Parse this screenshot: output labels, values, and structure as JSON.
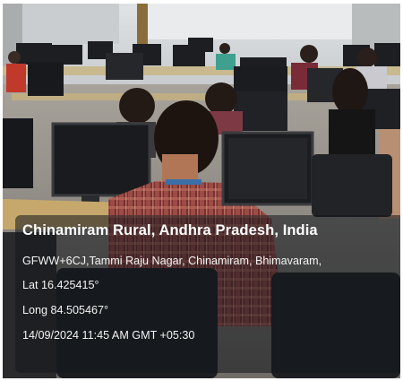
{
  "photo": {
    "scene": "computer-lab-students"
  },
  "geotag": {
    "place": "Chinamiram Rural, Andhra Pradesh, India",
    "address": "GFWW+6CJ,Tammi Raju Nagar, Chinamiram, Bhimavaram,",
    "latitude": "Lat 16.425415°",
    "longitude": "Long 84.505467°",
    "timestamp": "14/09/2024 11:45 AM GMT +05:30"
  },
  "colors": {
    "caption_bg": "#12161c",
    "caption_text": "#ffffff",
    "shirt_check": "#8a3a3a",
    "wall": "#e6e8ea"
  }
}
